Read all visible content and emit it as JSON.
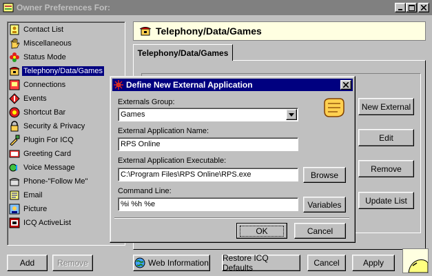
{
  "window": {
    "title": "Owner Preferences For:",
    "controls": [
      "_",
      "□",
      "×"
    ]
  },
  "sidebar": {
    "items": [
      {
        "label": "Contact List",
        "icon": "contact-list-icon"
      },
      {
        "label": "Miscellaneous",
        "icon": "hand-icon"
      },
      {
        "label": "Status Mode",
        "icon": "flower-icon"
      },
      {
        "label": "Telephony/Data/Games",
        "icon": "phone-icon"
      },
      {
        "label": "Connections",
        "icon": "connections-icon"
      },
      {
        "label": "Events",
        "icon": "events-icon"
      },
      {
        "label": "Shortcut Bar",
        "icon": "shortcut-icon"
      },
      {
        "label": "Security & Privacy",
        "icon": "lock-icon"
      },
      {
        "label": "Plugin For ICQ",
        "icon": "plugin-icon"
      },
      {
        "label": "Greeting Card",
        "icon": "card-icon"
      },
      {
        "label": "Voice Message",
        "icon": "voice-icon"
      },
      {
        "label": "Phone-\"Follow Me\"",
        "icon": "phone-follow-icon"
      },
      {
        "label": "Email",
        "icon": "email-icon"
      },
      {
        "label": "Picture",
        "icon": "picture-icon"
      },
      {
        "label": "ICQ ActiveList",
        "icon": "activelist-icon"
      }
    ],
    "selected_index": 3
  },
  "header": {
    "title": "Telephony/Data/Games"
  },
  "tab": {
    "label": "Telephony/Data/Games"
  },
  "panel_buttons": {
    "new_external": "New External",
    "edit": "Edit",
    "remove": "Remove",
    "update_list": "Update List"
  },
  "dialog": {
    "title": "Define New External Application",
    "group_label": "Externals Group:",
    "group_value": "Games",
    "name_label": "External Application Name:",
    "name_value": "RPS Online",
    "exe_label": "External Application Executable:",
    "exe_value": "C:\\Program Files\\RPS Online\\RPS.exe",
    "browse": "Browse",
    "cmd_label": "Command Line:",
    "cmd_value": "%i %h %e",
    "variables": "Variables",
    "ok": "OK",
    "cancel": "Cancel"
  },
  "footer": {
    "add": "Add",
    "remove": "Remove",
    "web_info": "Web Information",
    "restore": "Restore ICQ Defaults",
    "cancel": "Cancel",
    "apply": "Apply"
  },
  "colors": {
    "selection": "#000080",
    "header_bg": "#ffffe1",
    "face": "#c0c0c0"
  }
}
